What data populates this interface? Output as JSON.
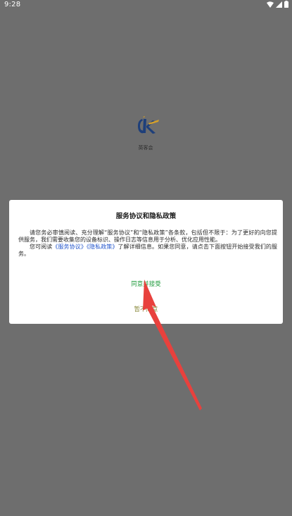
{
  "status_bar": {
    "time": "9:28",
    "icons": [
      "wifi-icon",
      "signal-icon",
      "battery-icon"
    ]
  },
  "splash": {
    "app_name": "英客会",
    "logo_icon": "jk-logo-icon"
  },
  "dialog": {
    "title": "服务协议和隐私政策",
    "paragraph1": "请您务必审慎阅读、充分理解“服务协议”和“隐私政策”各条款，包括但不限于：为了更好的向您提供服务，我们需要收集您的设备标识、操作日志等信息用于分析、优化应用性能。",
    "paragraph2_prefix": "您可阅读",
    "link_service": "《服务协议》",
    "link_privacy": "《隐私政策》",
    "paragraph2_suffix": "了解详细信息。如果您同意，请点击下面按钮开始接受我们的服务。",
    "agree_label": "同意并接受",
    "disagree_label": "暂不同意"
  },
  "colors": {
    "overlay": "#6e6e6e",
    "agree": "#1e9a3b",
    "disagree": "#8a8a3c",
    "link": "#2255cc",
    "arrow": "#e8413d"
  }
}
